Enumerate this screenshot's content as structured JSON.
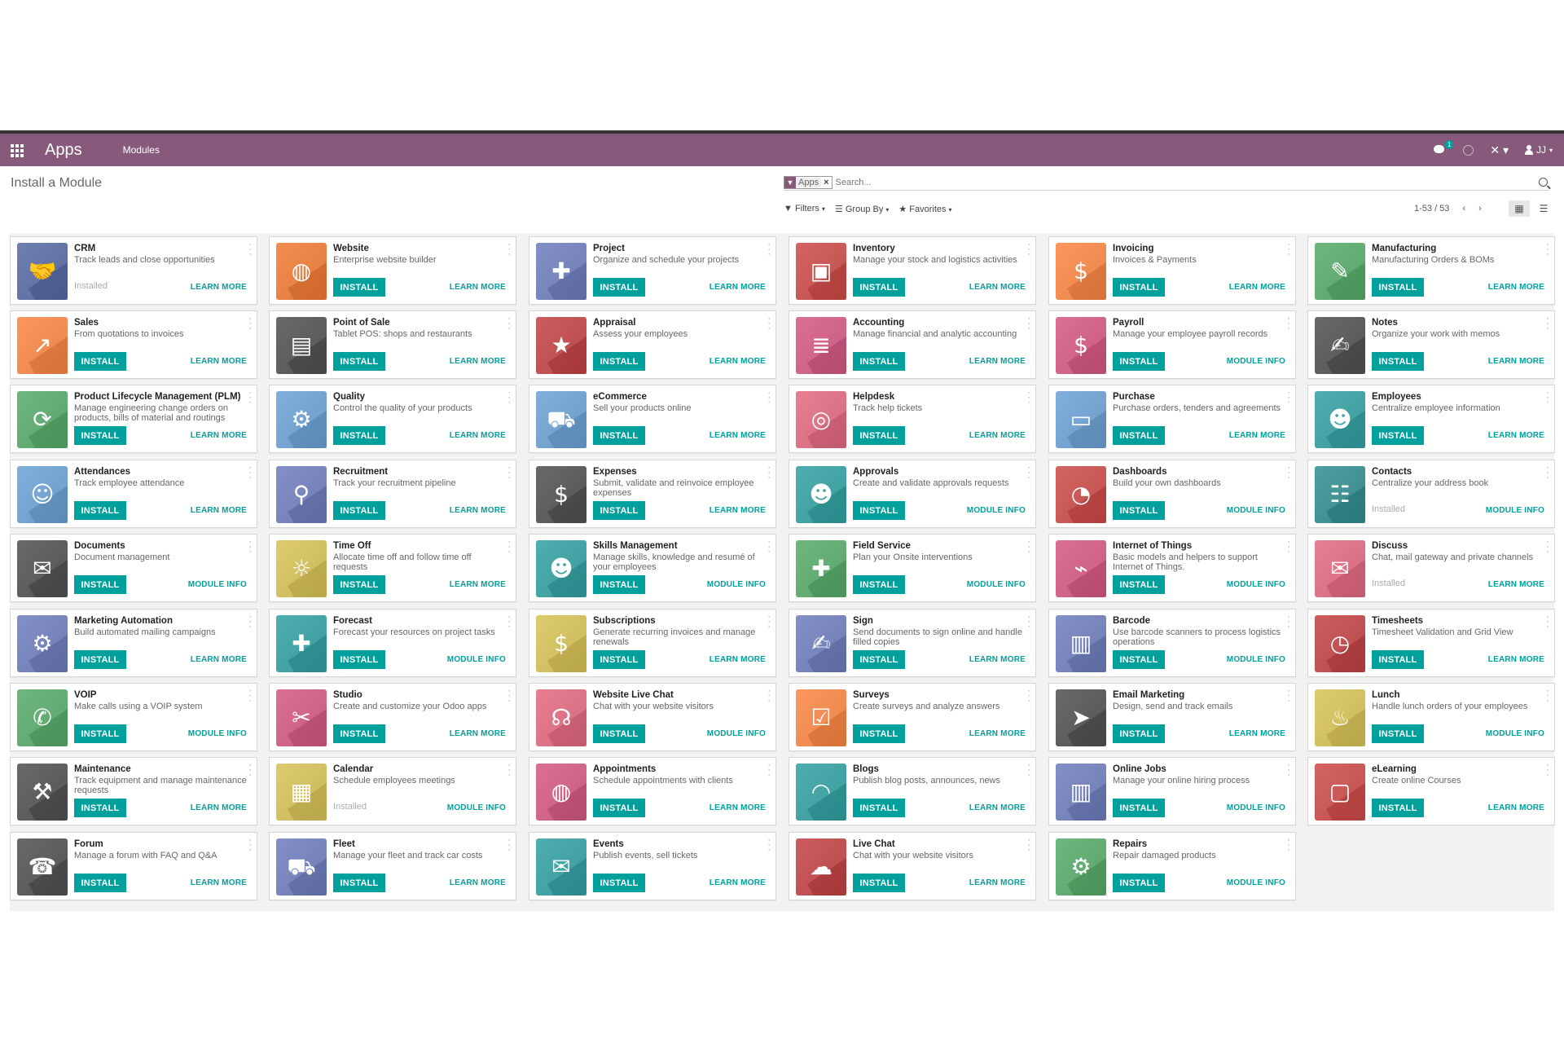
{
  "navbar": {
    "brand": "Apps",
    "menu_modules": "Modules",
    "chat_badge": "1",
    "user_initials": "JJ"
  },
  "control_panel": {
    "breadcrumb": "Install a Module",
    "facet_label": "Apps",
    "facet_remove": "×",
    "search_placeholder": "Search...",
    "filters_label": "Filters",
    "groupby_label": "Group By",
    "favorites_label": "Favorites",
    "pager_value": "1-53 / 53"
  },
  "colors": {
    "navbar": "#875a7b",
    "primary": "#00a09d"
  },
  "apps": [
    {
      "name": "CRM",
      "desc": "Track leads and close opportunities",
      "state": "installed",
      "link": "LEARN MORE",
      "color": "#5a6b9e",
      "icon": "handshake-icon"
    },
    {
      "name": "Website",
      "desc": "Enterprise website builder",
      "state": "install",
      "link": "LEARN MORE",
      "color": "#e07a3c",
      "icon": "globe-icon"
    },
    {
      "name": "Project",
      "desc": "Organize and schedule your projects",
      "state": "install",
      "link": "LEARN MORE",
      "color": "#6f7cb3",
      "icon": "puzzle-icon"
    },
    {
      "name": "Inventory",
      "desc": "Manage your stock and logistics activities",
      "state": "install",
      "link": "LEARN MORE",
      "color": "#c0504d",
      "icon": "box-icon"
    },
    {
      "name": "Invoicing",
      "desc": "Invoices & Payments",
      "state": "install",
      "link": "LEARN MORE",
      "color": "#e8834a",
      "icon": "invoice-icon"
    },
    {
      "name": "Manufacturing",
      "desc": "Manufacturing Orders & BOMs",
      "state": "install",
      "link": "LEARN MORE",
      "color": "#5aa36b",
      "icon": "wrench-icon"
    },
    {
      "name": "Sales",
      "desc": "From quotations to invoices",
      "state": "install",
      "link": "LEARN MORE",
      "color": "#e8834a",
      "icon": "chart-icon"
    },
    {
      "name": "Point of Sale",
      "desc": "Tablet POS: shops and restaurants",
      "state": "install",
      "link": "LEARN MORE",
      "color": "#555555",
      "icon": "store-icon"
    },
    {
      "name": "Appraisal",
      "desc": "Assess your employees",
      "state": "install",
      "link": "LEARN MORE",
      "color": "#b8494b",
      "icon": "star-icon"
    },
    {
      "name": "Accounting",
      "desc": "Manage financial and analytic accounting",
      "state": "install",
      "link": "LEARN MORE",
      "color": "#c75b80",
      "icon": "document-icon"
    },
    {
      "name": "Payroll",
      "desc": "Manage your employee payroll records",
      "state": "install",
      "link": "MODULE INFO",
      "color": "#c75b80",
      "icon": "payroll-icon"
    },
    {
      "name": "Notes",
      "desc": "Organize your work with memos",
      "state": "install",
      "link": "LEARN MORE",
      "color": "#555555",
      "icon": "notes-icon"
    },
    {
      "name": "Product Lifecycle Management (PLM)",
      "desc": "Manage engineering change orders on products, bills of material and routings",
      "state": "install",
      "link": "LEARN MORE",
      "color": "#5aa36b",
      "icon": "cycle-icon"
    },
    {
      "name": "Quality",
      "desc": "Control the quality of your products",
      "state": "install",
      "link": "LEARN MORE",
      "color": "#6c9bc7",
      "icon": "gear-check-icon"
    },
    {
      "name": "eCommerce",
      "desc": "Sell your products online",
      "state": "install",
      "link": "LEARN MORE",
      "color": "#6c9bc7",
      "icon": "cart-icon"
    },
    {
      "name": "Helpdesk",
      "desc": "Track help tickets",
      "state": "install",
      "link": "LEARN MORE",
      "color": "#d46a7e",
      "icon": "lifebuoy-icon"
    },
    {
      "name": "Purchase",
      "desc": "Purchase orders, tenders and agreements",
      "state": "install",
      "link": "LEARN MORE",
      "color": "#6c9bc7",
      "icon": "card-icon"
    },
    {
      "name": "Employees",
      "desc": "Centralize employee information",
      "state": "install",
      "link": "LEARN MORE",
      "color": "#3b9a9b",
      "icon": "people-icon"
    },
    {
      "name": "Attendances",
      "desc": "Track employee attendance",
      "state": "install",
      "link": "LEARN MORE",
      "color": "#6c9bc7",
      "icon": "attendance-icon"
    },
    {
      "name": "Recruitment",
      "desc": "Track your recruitment pipeline",
      "state": "install",
      "link": "LEARN MORE",
      "color": "#6f7cb3",
      "icon": "magnifier-icon"
    },
    {
      "name": "Expenses",
      "desc": "Submit, validate and reinvoice employee expenses",
      "state": "install",
      "link": "LEARN MORE",
      "color": "#555555",
      "icon": "expense-icon"
    },
    {
      "name": "Approvals",
      "desc": "Create and validate approvals requests",
      "state": "install",
      "link": "MODULE INFO",
      "color": "#3b9a9b",
      "icon": "people-icon"
    },
    {
      "name": "Dashboards",
      "desc": "Build your own dashboards",
      "state": "install",
      "link": "MODULE INFO",
      "color": "#c0504d",
      "icon": "gauge-icon"
    },
    {
      "name": "Contacts",
      "desc": "Centralize your address book",
      "state": "installed",
      "link": "MODULE INFO",
      "color": "#3b8a8b",
      "icon": "contact-book-icon"
    },
    {
      "name": "Documents",
      "desc": "Document management",
      "state": "install",
      "link": "MODULE INFO",
      "color": "#555555",
      "icon": "inbox-icon"
    },
    {
      "name": "Time Off",
      "desc": "Allocate time off and follow time off requests",
      "state": "install",
      "link": "LEARN MORE",
      "color": "#c9b85a",
      "icon": "timeoff-icon"
    },
    {
      "name": "Skills Management",
      "desc": "Manage skills, knowledge and resumé of your employees",
      "state": "install",
      "link": "MODULE INFO",
      "color": "#3b9a9b",
      "icon": "people-icon"
    },
    {
      "name": "Field Service",
      "desc": "Plan your Onsite interventions",
      "state": "install",
      "link": "MODULE INFO",
      "color": "#5aa36b",
      "icon": "fieldservice-icon"
    },
    {
      "name": "Internet of Things",
      "desc": "Basic models and helpers to support Internet of Things.",
      "state": "install",
      "link": "MODULE INFO",
      "color": "#c75b80",
      "icon": "iot-icon"
    },
    {
      "name": "Discuss",
      "desc": "Chat, mail gateway and private channels",
      "state": "installed",
      "link": "LEARN MORE",
      "color": "#d46a7e",
      "icon": "chat-bubble-icon"
    },
    {
      "name": "Marketing Automation",
      "desc": "Build automated mailing campaigns",
      "state": "install",
      "link": "LEARN MORE",
      "color": "#6f7cb3",
      "icon": "gear-icon"
    },
    {
      "name": "Forecast",
      "desc": "Forecast your resources on project tasks",
      "state": "install",
      "link": "MODULE INFO",
      "color": "#3b9a9b",
      "icon": "forecast-icon"
    },
    {
      "name": "Subscriptions",
      "desc": "Generate recurring invoices and manage renewals",
      "state": "install",
      "link": "LEARN MORE",
      "color": "#c9b85a",
      "icon": "subscription-icon"
    },
    {
      "name": "Sign",
      "desc": "Send documents to sign online and handle filled copies",
      "state": "install",
      "link": "LEARN MORE",
      "color": "#6f7cb3",
      "icon": "sign-icon"
    },
    {
      "name": "Barcode",
      "desc": "Use barcode scanners to process logistics operations",
      "state": "install",
      "link": "MODULE INFO",
      "color": "#6f7cb3",
      "icon": "barcode-box-icon"
    },
    {
      "name": "Timesheets",
      "desc": "Timesheet Validation and Grid View",
      "state": "install",
      "link": "LEARN MORE",
      "color": "#b8494b",
      "icon": "timer-icon"
    },
    {
      "name": "VOIP",
      "desc": "Make calls using a VOIP system",
      "state": "install",
      "link": "MODULE INFO",
      "color": "#5aa36b",
      "icon": "phone-icon"
    },
    {
      "name": "Studio",
      "desc": "Create and customize your Odoo apps",
      "state": "install",
      "link": "LEARN MORE",
      "color": "#c75b80",
      "icon": "tools-icon"
    },
    {
      "name": "Website Live Chat",
      "desc": "Chat with your website visitors",
      "state": "install",
      "link": "MODULE INFO",
      "color": "#d46a7e",
      "icon": "headset-icon"
    },
    {
      "name": "Surveys",
      "desc": "Create surveys and analyze answers",
      "state": "install",
      "link": "LEARN MORE",
      "color": "#e8834a",
      "icon": "survey-icon"
    },
    {
      "name": "Email Marketing",
      "desc": "Design, send and track emails",
      "state": "install",
      "link": "LEARN MORE",
      "color": "#555555",
      "icon": "paper-plane-icon"
    },
    {
      "name": "Lunch",
      "desc": "Handle lunch orders of your employees",
      "state": "install",
      "link": "MODULE INFO",
      "color": "#c9b85a",
      "icon": "cutlery-icon"
    },
    {
      "name": "Maintenance",
      "desc": "Track equipment and manage maintenance requests",
      "state": "install",
      "link": "LEARN MORE",
      "color": "#555555",
      "icon": "hammer-icon"
    },
    {
      "name": "Calendar",
      "desc": "Schedule employees meetings",
      "state": "installed",
      "link": "MODULE INFO",
      "color": "#c9b85a",
      "icon": "calendar-icon"
    },
    {
      "name": "Appointments",
      "desc": "Schedule appointments with clients",
      "state": "install",
      "link": "LEARN MORE",
      "color": "#c75b80",
      "icon": "globe-calendar-icon"
    },
    {
      "name": "Blogs",
      "desc": "Publish blog posts, announces, news",
      "state": "install",
      "link": "LEARN MORE",
      "color": "#3b9a9b",
      "icon": "rss-icon"
    },
    {
      "name": "Online Jobs",
      "desc": "Manage your online hiring process",
      "state": "install",
      "link": "MODULE INFO",
      "color": "#6f7cb3",
      "icon": "briefcase-icon"
    },
    {
      "name": "eLearning",
      "desc": "Create online Courses",
      "state": "install",
      "link": "LEARN MORE",
      "color": "#c0504d",
      "icon": "elearning-icon"
    },
    {
      "name": "Forum",
      "desc": "Manage a forum with FAQ and Q&A",
      "state": "install",
      "link": "LEARN MORE",
      "color": "#555555",
      "icon": "forum-icon"
    },
    {
      "name": "Fleet",
      "desc": "Manage your fleet and track car costs",
      "state": "install",
      "link": "LEARN MORE",
      "color": "#6f7cb3",
      "icon": "car-icon"
    },
    {
      "name": "Events",
      "desc": "Publish events, sell tickets",
      "state": "install",
      "link": "LEARN MORE",
      "color": "#3b9a9b",
      "icon": "ticket-icon"
    },
    {
      "name": "Live Chat",
      "desc": "Chat with your website visitors",
      "state": "install",
      "link": "LEARN MORE",
      "color": "#b8494b",
      "icon": "chat-bubbles-icon"
    },
    {
      "name": "Repairs",
      "desc": "Repair damaged products",
      "state": "install",
      "link": "MODULE INFO",
      "color": "#5aa36b",
      "icon": "repair-icon"
    }
  ],
  "install_label": "INSTALL",
  "installed_label": "Installed"
}
